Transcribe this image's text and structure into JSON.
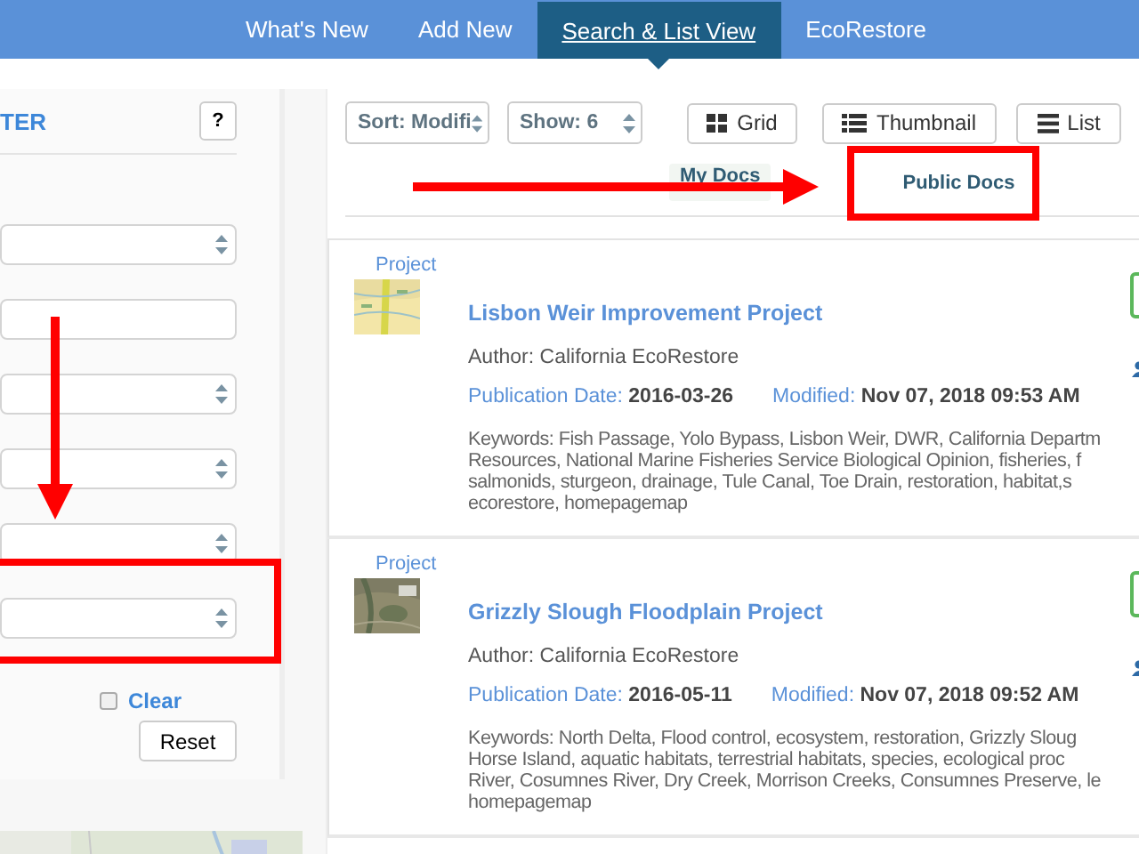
{
  "nav": {
    "items": [
      {
        "label": "What's New",
        "selected": false
      },
      {
        "label": "Add New",
        "selected": false
      },
      {
        "label": "Search & List View",
        "selected": true
      },
      {
        "label": "EcoRestore",
        "selected": false
      }
    ]
  },
  "filter_panel": {
    "title": "TER",
    "help": "?",
    "fields": [
      {
        "kind": "select"
      },
      {
        "kind": "input"
      },
      {
        "kind": "select"
      },
      {
        "kind": "select"
      },
      {
        "kind": "select"
      },
      {
        "kind": "select"
      }
    ],
    "clear": {
      "label": "Clear",
      "checked": false
    },
    "reset": "Reset"
  },
  "toolbar": {
    "sort": "Sort: Modifi",
    "show": "Show: 6",
    "views": [
      {
        "kind": "grid",
        "label": "Grid"
      },
      {
        "kind": "thumbnail",
        "label": "Thumbnail"
      },
      {
        "kind": "list",
        "label": "List"
      }
    ]
  },
  "doc_tabs": [
    {
      "label": "My Docs",
      "selected": false
    },
    {
      "label": "Public Docs",
      "selected": true
    }
  ],
  "results": [
    {
      "type": "Project",
      "title": "Lisbon Weir Improvement Project",
      "author": "Author: California EcoRestore",
      "publication_label": "Publication Date:",
      "publication_date": "2016-03-26",
      "modified_label": "Modified:",
      "modified": "Nov 07, 2018 09:53 AM",
      "keywords": [
        "Keywords: Fish Passage, Yolo Bypass, Lisbon Weir, DWR, California Departm",
        "Resources, National Marine Fisheries Service Biological Opinion, fisheries, f",
        "salmonids, sturgeon, drainage, Tule Canal, Toe Drain, restoration, habitat,s",
        "ecorestore, homepagemap"
      ]
    },
    {
      "type": "Project",
      "title": "Grizzly Slough Floodplain Project",
      "author": "Author: California EcoRestore",
      "publication_label": "Publication Date:",
      "publication_date": "2016-05-11",
      "modified_label": "Modified:",
      "modified": "Nov 07, 2018 09:52 AM",
      "keywords": [
        "Keywords: North Delta, Flood control, ecosystem, restoration, Grizzly Sloug",
        "Horse Island, aquatic habitats, terrestrial habitats, species, ecological proc",
        "River, Cosumnes River, Dry Creek, Morrison Creeks, Consumnes Preserve, le",
        "homepagemap"
      ]
    }
  ],
  "annotations": [
    {
      "kind": "arrow"
    },
    {
      "kind": "frame"
    },
    {
      "kind": "arrow"
    },
    {
      "kind": "frame"
    }
  ]
}
